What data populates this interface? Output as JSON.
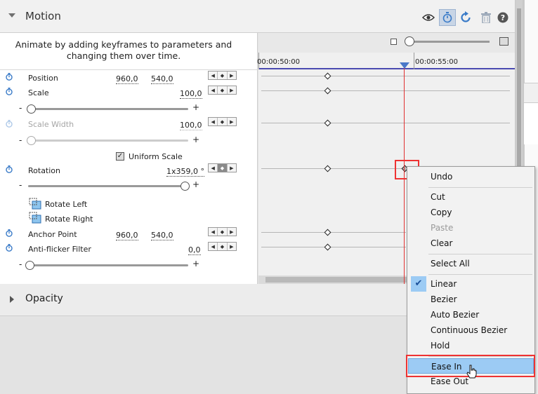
{
  "motion": {
    "title": "Motion",
    "tip": "Animate by adding keyframes to parameters and changing them over time.",
    "properties": {
      "position": {
        "label": "Position",
        "x": "960,0",
        "y": "540,0"
      },
      "scale": {
        "label": "Scale",
        "value": "100,0",
        "minus": "-",
        "plus": "+"
      },
      "scale_width": {
        "label": "Scale Width",
        "value": "100,0",
        "minus": "-",
        "plus": "+"
      },
      "uniform_scale": {
        "label": "Uniform Scale",
        "checked": true
      },
      "rotation": {
        "label": "Rotation",
        "value": "1x359,0 °",
        "minus": "-",
        "plus": "+"
      },
      "rotate_left": {
        "label": "Rotate Left"
      },
      "rotate_right": {
        "label": "Rotate Right"
      },
      "anchor_point": {
        "label": "Anchor Point",
        "x": "960,0",
        "y": "540,0"
      },
      "anti_flicker": {
        "label": "Anti-flicker Filter",
        "value": "0,0",
        "minus": "-",
        "plus": "+"
      }
    },
    "nav_glyphs": {
      "prev": "◀",
      "add": "◆",
      "next": "▶"
    }
  },
  "timeline": {
    "ruler_labels": [
      "00:00:50:00",
      "00:00:55:00"
    ]
  },
  "opacity": {
    "title": "Opacity"
  },
  "context_menu": {
    "items": [
      {
        "label": "Undo"
      },
      {
        "label": "Cut"
      },
      {
        "label": "Copy"
      },
      {
        "label": "Paste",
        "disabled": true
      },
      {
        "label": "Clear"
      },
      {
        "label": "Select All"
      },
      {
        "label": "Linear",
        "checked": true
      },
      {
        "label": "Bezier"
      },
      {
        "label": "Auto Bezier"
      },
      {
        "label": "Continuous Bezier"
      },
      {
        "label": "Hold"
      },
      {
        "label": "Ease In",
        "highlighted": true
      },
      {
        "label": "Ease Out"
      }
    ],
    "check_glyph": "✔"
  },
  "colors": {
    "accent_highlight": "#9ccbf4",
    "annotation_red": "#e33333",
    "playhead": "#e03030",
    "stopwatch_blue": "#3a7bc8"
  }
}
